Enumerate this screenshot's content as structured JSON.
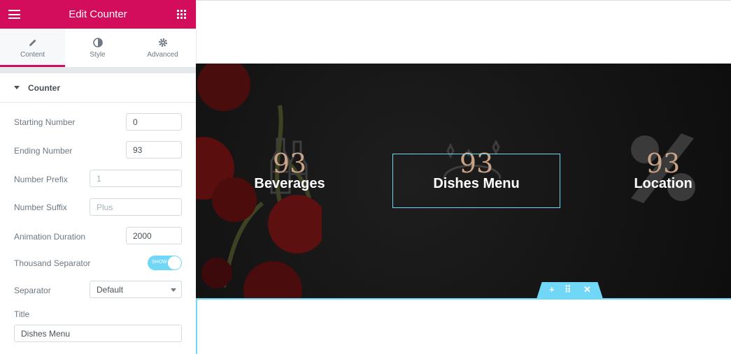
{
  "panel": {
    "title": "Edit Counter",
    "tabs": [
      {
        "label": "Content",
        "icon": "pencil-icon"
      },
      {
        "label": "Style",
        "icon": "half-circle-icon"
      },
      {
        "label": "Advanced",
        "icon": "gear-icon"
      }
    ],
    "section": "Counter",
    "fields": {
      "starting_number": {
        "label": "Starting Number",
        "value": "0"
      },
      "ending_number": {
        "label": "Ending Number",
        "value": "93"
      },
      "number_prefix": {
        "label": "Number Prefix",
        "placeholder": "1"
      },
      "number_suffix": {
        "label": "Number Suffix",
        "placeholder": "Plus"
      },
      "animation_duration": {
        "label": "Animation Duration",
        "value": "2000"
      },
      "thousand_separator": {
        "label": "Thousand Separator",
        "toggle_text": "SHOW",
        "on": true
      },
      "separator": {
        "label": "Separator",
        "value": "Default"
      },
      "title": {
        "label": "Title",
        "value": "Dishes Menu"
      }
    }
  },
  "canvas": {
    "counters": [
      {
        "number": "93",
        "title": "Beverages",
        "icon": "bottles-icon"
      },
      {
        "number": "93",
        "title": "Dishes Menu",
        "icon": "cloche-icon"
      },
      {
        "number": "93",
        "title": "Location",
        "icon": "percent-icon"
      }
    ],
    "section_controls": [
      "+",
      "⠿",
      "✕"
    ]
  },
  "colors": {
    "brand": "#d30c5c",
    "accent": "#71d7f7",
    "number": "#c8a286"
  }
}
